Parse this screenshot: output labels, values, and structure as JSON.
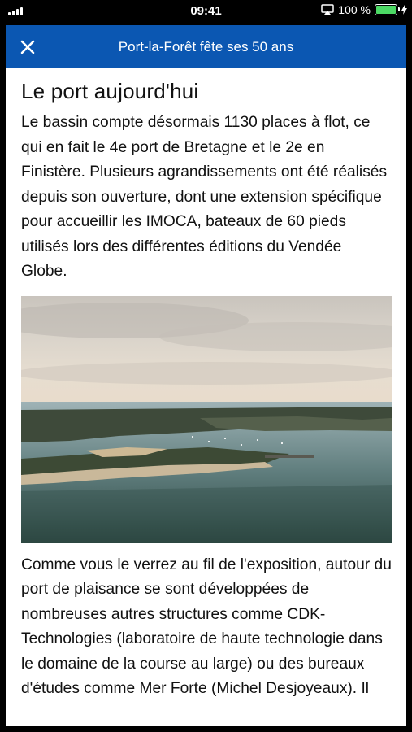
{
  "status_bar": {
    "time": "09:41",
    "battery_text": "100 %",
    "battery_level_percent": 100,
    "icons": [
      "signal-bars-icon",
      "airplay-icon",
      "battery-icon",
      "charging-bolt-icon"
    ]
  },
  "header": {
    "title": "Port-la-Forêt fête ses 50 ans",
    "close_icon": "close-icon",
    "background_color": "#0b57b2"
  },
  "article": {
    "heading": "Le port aujourd'hui",
    "paragraph_1": "Le bassin compte désormais 1130 places à flot, ce qui en fait le 4e port de Bretagne et le 2e en Finistère. Plusieurs agrandissements ont été réalisés depuis son ouverture, dont une extension spécifique pour accueillir les IMOCA, bateaux de 60 pieds utilisés lors des différentes éditions du Vendée Globe.",
    "paragraph_2": "Comme vous le verrez au fil de l'exposition, autour du port de plaisance se sont développées de nombreuses autres structures comme CDK-Technologies (laboratoire de haute technologie dans le domaine de la course au large) ou des bureaux d'études comme Mer Forte (Michel Desjoyeaux). Il"
  }
}
